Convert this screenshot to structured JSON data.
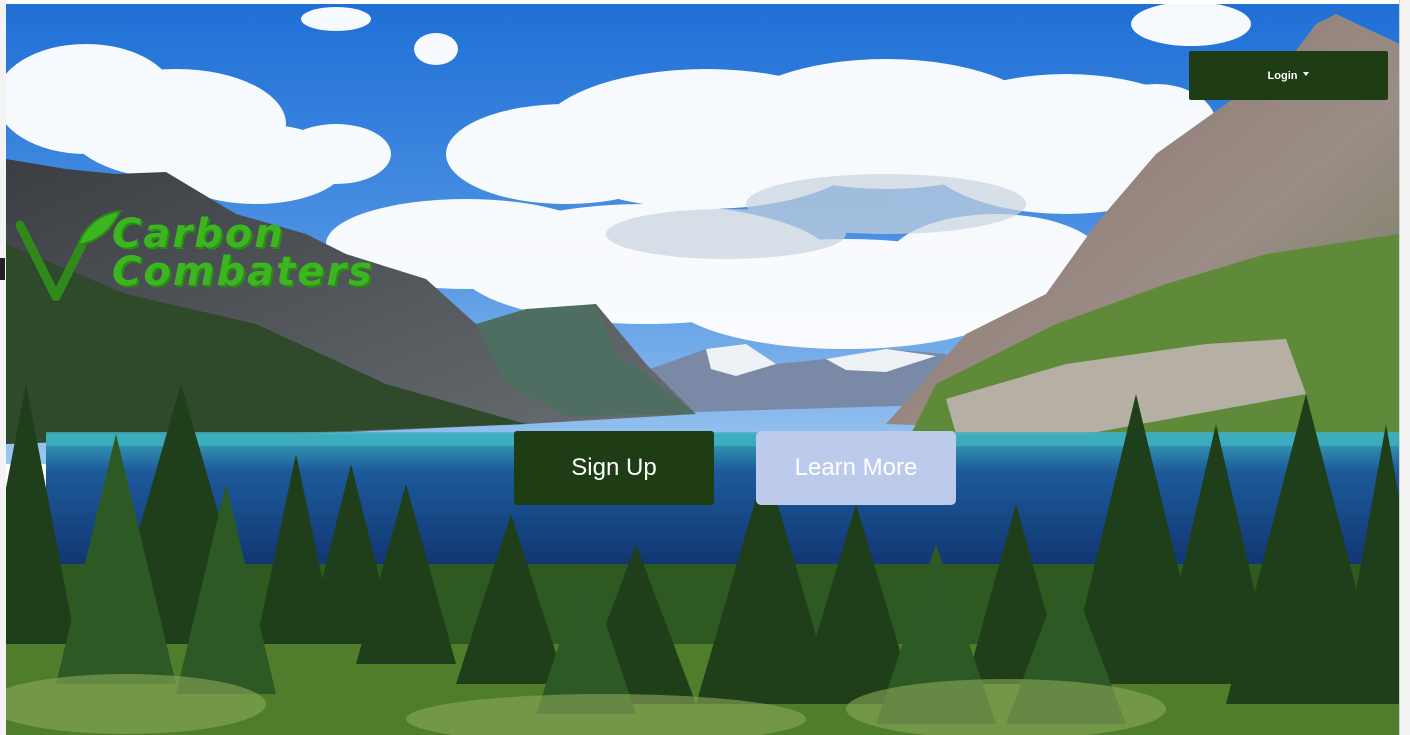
{
  "header": {
    "login_label": "Login"
  },
  "logo": {
    "line1": "Carbon",
    "line2": "Combaters"
  },
  "hero": {
    "signup_label": "Sign Up",
    "learn_more_label": "Learn More",
    "background": "mountain-lake-landscape"
  },
  "colors": {
    "primary_dark_green": "#1e3d15",
    "logo_green": "#3cb521",
    "learn_more_bg": "#bccbeb"
  }
}
